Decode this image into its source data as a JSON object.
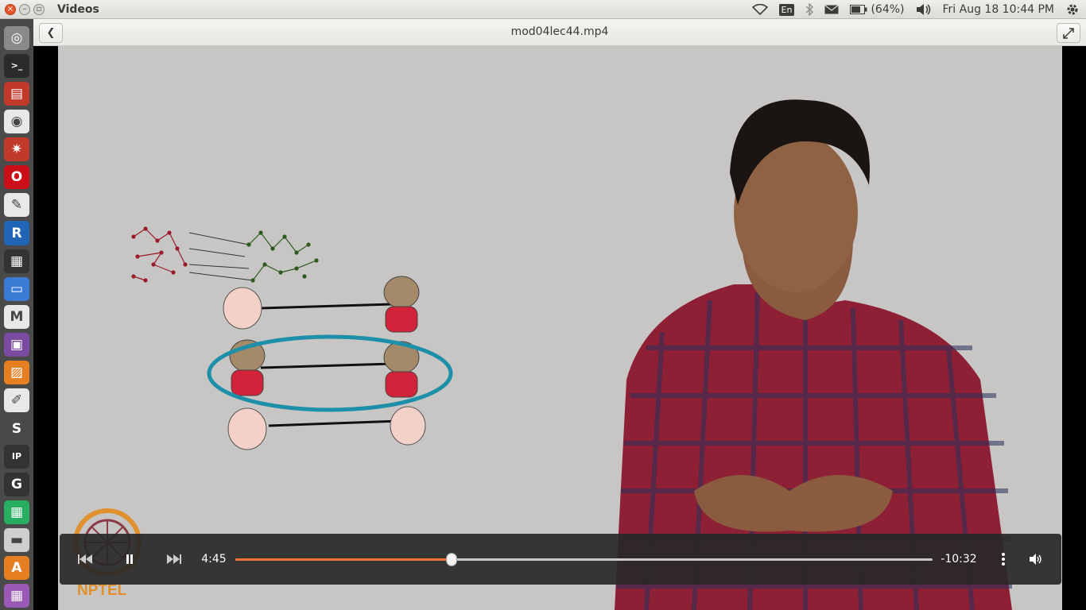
{
  "window": {
    "app_title": "Videos",
    "video_title": "mod04lec44.mp4"
  },
  "top_panel": {
    "keyboard_layout": "En",
    "battery_text": "(64%)",
    "datetime": "Fri Aug 18 10:44 PM"
  },
  "launcher": {
    "items": [
      {
        "name": "dash-home",
        "icon": "ubuntu-logo-icon",
        "bg": "#8a8a8a"
      },
      {
        "name": "terminal",
        "icon": "terminal-icon",
        "bg": "#2b2b2b"
      },
      {
        "name": "file-archive",
        "icon": "archive-icon",
        "bg": "#c0392b"
      },
      {
        "name": "chrome",
        "icon": "chrome-icon",
        "bg": "#e8e8e8"
      },
      {
        "name": "settings-app",
        "icon": "gear-app-icon",
        "bg": "#c0392b"
      },
      {
        "name": "opera",
        "icon": "opera-icon",
        "bg": "#cc0f16"
      },
      {
        "name": "image-viewer",
        "icon": "image-viewer-icon",
        "bg": "#e8e8e8"
      },
      {
        "name": "r-lang",
        "icon": "r-icon",
        "bg": "#2165b6"
      },
      {
        "name": "video-editor",
        "icon": "clapperboard-icon",
        "bg": "#333333"
      },
      {
        "name": "document-viewer",
        "icon": "document-icon",
        "bg": "#3a7bd5"
      },
      {
        "name": "gmail",
        "icon": "gmail-icon",
        "bg": "#e8e8e8"
      },
      {
        "name": "media-player",
        "icon": "film-icon",
        "bg": "#7a4ba0"
      },
      {
        "name": "presentation",
        "icon": "presentation-icon",
        "bg": "#e67e22"
      },
      {
        "name": "text-editor",
        "icon": "text-editor-icon",
        "bg": "#e8e8e8"
      },
      {
        "name": "sublime-text",
        "icon": "sublime-icon",
        "bg": "#4a4a4a"
      },
      {
        "name": "ipython",
        "icon": "ipython-icon",
        "bg": "#333333"
      },
      {
        "name": "gephi",
        "icon": "gephi-icon",
        "bg": "#333333"
      },
      {
        "name": "spreadsheet",
        "icon": "spreadsheet-icon",
        "bg": "#27ae60"
      },
      {
        "name": "drive",
        "icon": "drive-icon",
        "bg": "#cfcfcf"
      },
      {
        "name": "software-center",
        "icon": "software-center-icon",
        "bg": "#e67e22"
      },
      {
        "name": "workspaces",
        "icon": "workspaces-icon",
        "bg": "#9b59b6"
      }
    ]
  },
  "player": {
    "elapsed": "4:45",
    "remaining": "-10:32",
    "progress": 0.31,
    "accent_color": "#f27333"
  },
  "video": {
    "watermark": "NPTEL"
  }
}
